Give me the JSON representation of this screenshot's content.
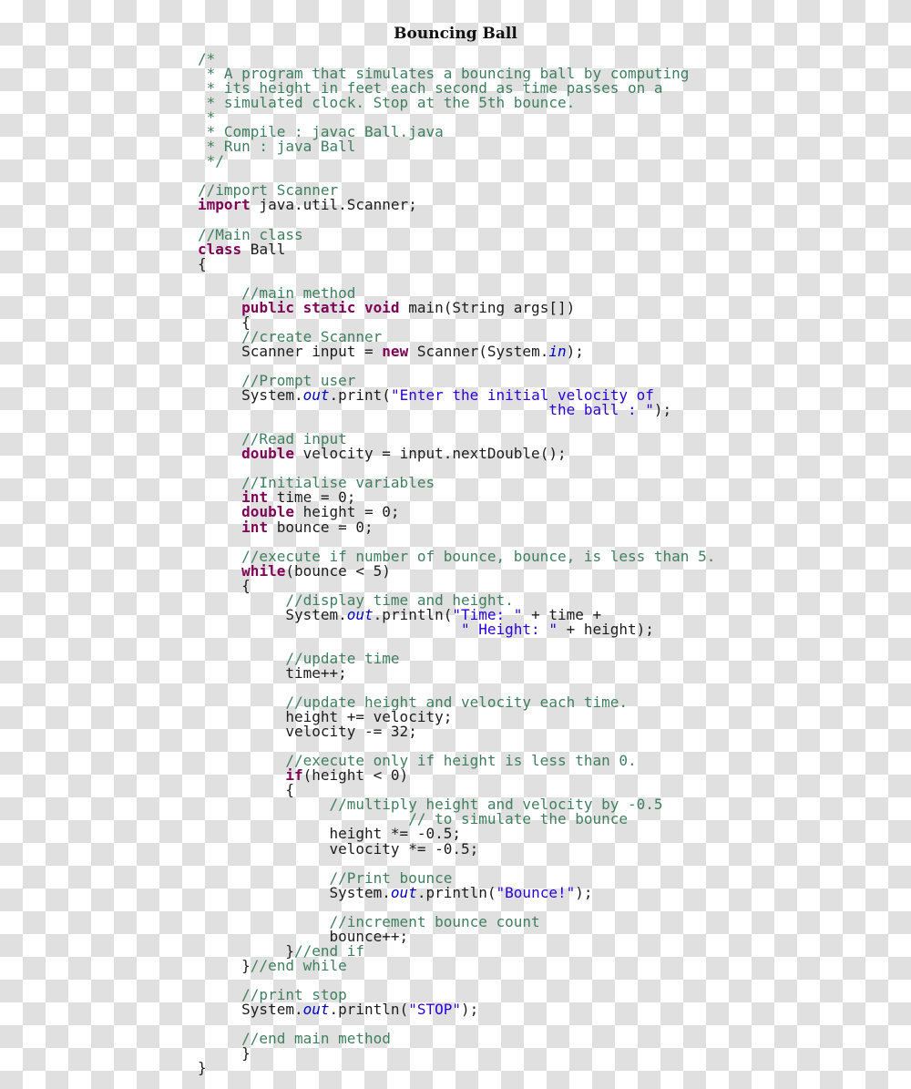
{
  "document": {
    "title": "Bouncing Ball",
    "language": "java",
    "file_name": "Ball.java",
    "colors": {
      "comment": "#3f7f5f",
      "keyword": "#7f0055",
      "string": "#2a00d8",
      "field": "#0000c0",
      "plain": "#1c1c1c",
      "background_light": "#ffffff",
      "background_dark": "#e0e0e0"
    }
  },
  "code": {
    "lines": [
      [
        {
          "t": "/*",
          "c": "c"
        }
      ],
      [
        {
          "t": " * A program that simulates a bouncing ball by computing",
          "c": "c"
        }
      ],
      [
        {
          "t": " * its height in feet each second as time passes on a",
          "c": "c"
        }
      ],
      [
        {
          "t": " * simulated clock. Stop at the 5th bounce.",
          "c": "c"
        }
      ],
      [
        {
          "t": " *",
          "c": "c"
        }
      ],
      [
        {
          "t": " * Compile : javac Ball.java",
          "c": "c"
        }
      ],
      [
        {
          "t": " * Run : java Ball",
          "c": "c"
        }
      ],
      [
        {
          "t": " */",
          "c": "c"
        }
      ],
      [],
      [
        {
          "t": "//import Scanner",
          "c": "c"
        }
      ],
      [
        {
          "t": "import",
          "c": "k"
        },
        {
          "t": " java.util.Scanner;",
          "c": "p"
        }
      ],
      [],
      [
        {
          "t": "//Main class",
          "c": "c"
        }
      ],
      [
        {
          "t": "class",
          "c": "k"
        },
        {
          "t": " Ball",
          "c": "p"
        }
      ],
      [
        {
          "t": "{",
          "c": "p"
        }
      ],
      [],
      [
        {
          "t": "     //main method",
          "c": "c"
        }
      ],
      [
        {
          "t": "     ",
          "c": "p"
        },
        {
          "t": "public static void",
          "c": "k"
        },
        {
          "t": " main(String args[])",
          "c": "p"
        }
      ],
      [
        {
          "t": "     {",
          "c": "p"
        }
      ],
      [
        {
          "t": "     //create Scanner",
          "c": "c"
        }
      ],
      [
        {
          "t": "     Scanner input = ",
          "c": "p"
        },
        {
          "t": "new",
          "c": "k"
        },
        {
          "t": " Scanner(System.",
          "c": "p"
        },
        {
          "t": "in",
          "c": "f"
        },
        {
          "t": ");",
          "c": "p"
        }
      ],
      [],
      [
        {
          "t": "     //Prompt user",
          "c": "c"
        }
      ],
      [
        {
          "t": "     System.",
          "c": "p"
        },
        {
          "t": "out",
          "c": "f"
        },
        {
          "t": ".print(",
          "c": "p"
        },
        {
          "t": "\"Enter the initial velocity of",
          "c": "s"
        }
      ],
      [
        {
          "t": "                                        ",
          "c": "p"
        },
        {
          "t": "the ball : \"",
          "c": "s"
        },
        {
          "t": ");",
          "c": "p"
        }
      ],
      [],
      [
        {
          "t": "     //Read input",
          "c": "c"
        }
      ],
      [
        {
          "t": "     ",
          "c": "p"
        },
        {
          "t": "double",
          "c": "k"
        },
        {
          "t": " velocity = input.nextDouble();",
          "c": "p"
        }
      ],
      [],
      [
        {
          "t": "     //Initialise variables",
          "c": "c"
        }
      ],
      [
        {
          "t": "     ",
          "c": "p"
        },
        {
          "t": "int",
          "c": "k"
        },
        {
          "t": " time = 0;",
          "c": "p"
        }
      ],
      [
        {
          "t": "     ",
          "c": "p"
        },
        {
          "t": "double",
          "c": "k"
        },
        {
          "t": " height = 0;",
          "c": "p"
        }
      ],
      [
        {
          "t": "     ",
          "c": "p"
        },
        {
          "t": "int",
          "c": "k"
        },
        {
          "t": " bounce = 0;",
          "c": "p"
        }
      ],
      [],
      [
        {
          "t": "     //execute if number of bounce, bounce, is less than 5.",
          "c": "c"
        }
      ],
      [
        {
          "t": "     ",
          "c": "p"
        },
        {
          "t": "while",
          "c": "k"
        },
        {
          "t": "(bounce < 5)",
          "c": "p"
        }
      ],
      [
        {
          "t": "     {",
          "c": "p"
        }
      ],
      [
        {
          "t": "          //display time and height.",
          "c": "c"
        }
      ],
      [
        {
          "t": "          System.",
          "c": "p"
        },
        {
          "t": "out",
          "c": "f"
        },
        {
          "t": ".println(",
          "c": "p"
        },
        {
          "t": "\"Time: \"",
          "c": "s"
        },
        {
          "t": " + time +",
          "c": "p"
        }
      ],
      [
        {
          "t": "                              ",
          "c": "p"
        },
        {
          "t": "\" Height: \"",
          "c": "s"
        },
        {
          "t": " + height);",
          "c": "p"
        }
      ],
      [],
      [
        {
          "t": "          //update time",
          "c": "c"
        }
      ],
      [
        {
          "t": "          time++;",
          "c": "p"
        }
      ],
      [],
      [
        {
          "t": "          //update height and velocity each time.",
          "c": "c"
        }
      ],
      [
        {
          "t": "          height += velocity;",
          "c": "p"
        }
      ],
      [
        {
          "t": "          velocity -= 32;",
          "c": "p"
        }
      ],
      [],
      [
        {
          "t": "          //execute only if height is less than 0.",
          "c": "c"
        }
      ],
      [
        {
          "t": "          ",
          "c": "p"
        },
        {
          "t": "if",
          "c": "k"
        },
        {
          "t": "(height < 0)",
          "c": "p"
        }
      ],
      [
        {
          "t": "          {",
          "c": "p"
        }
      ],
      [
        {
          "t": "               //multiply height and velocity by -0.5",
          "c": "c"
        }
      ],
      [
        {
          "t": "                        // to simulate the bounce",
          "c": "c"
        }
      ],
      [
        {
          "t": "               height *= -0.5;",
          "c": "p"
        }
      ],
      [
        {
          "t": "               velocity *= -0.5;",
          "c": "p"
        }
      ],
      [],
      [
        {
          "t": "               //Print bounce",
          "c": "c"
        }
      ],
      [
        {
          "t": "               System.",
          "c": "p"
        },
        {
          "t": "out",
          "c": "f"
        },
        {
          "t": ".println(",
          "c": "p"
        },
        {
          "t": "\"Bounce!\"",
          "c": "s"
        },
        {
          "t": ");",
          "c": "p"
        }
      ],
      [],
      [
        {
          "t": "               //increment bounce count",
          "c": "c"
        }
      ],
      [
        {
          "t": "               bounce++;",
          "c": "p"
        }
      ],
      [
        {
          "t": "          }",
          "c": "p"
        },
        {
          "t": "//end if",
          "c": "c"
        }
      ],
      [
        {
          "t": "     }",
          "c": "p"
        },
        {
          "t": "//end while",
          "c": "c"
        }
      ],
      [],
      [
        {
          "t": "     //print stop",
          "c": "c"
        }
      ],
      [
        {
          "t": "     System.",
          "c": "p"
        },
        {
          "t": "out",
          "c": "f"
        },
        {
          "t": ".println(",
          "c": "p"
        },
        {
          "t": "\"STOP\"",
          "c": "s"
        },
        {
          "t": ");",
          "c": "p"
        }
      ],
      [],
      [
        {
          "t": "     //end main method",
          "c": "c"
        }
      ],
      [
        {
          "t": "     }",
          "c": "p"
        }
      ],
      [
        {
          "t": "}",
          "c": "p"
        }
      ]
    ]
  }
}
